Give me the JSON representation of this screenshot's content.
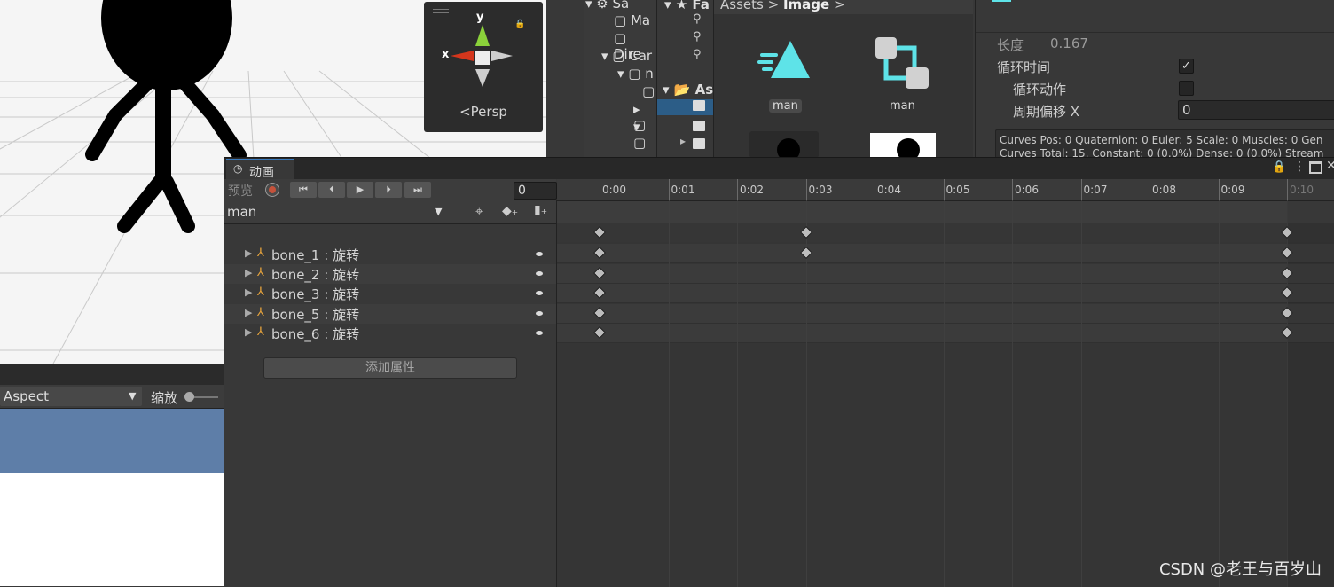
{
  "scene": {
    "gizmo": {
      "y_label": "y",
      "x_label": "x",
      "persp_label": "<Persp"
    }
  },
  "hierarchy": {
    "items": [
      "Sa",
      "Ma",
      "Dire",
      "Car",
      "n"
    ]
  },
  "favorites": {
    "label": "Fa"
  },
  "project": {
    "breadcrumb": [
      "Assets",
      "Image"
    ],
    "tree_label": "As",
    "assets": [
      {
        "name": "man",
        "selected": true
      },
      {
        "name": "man",
        "selected": false
      }
    ]
  },
  "inspector": {
    "length_label": "长度",
    "length_value": "0.167",
    "loop_time_label": "循环时间",
    "loop_time_checked": true,
    "loop_pose_label": "循环动作",
    "loop_pose_checked": false,
    "cycle_offset_label": "周期偏移 X",
    "cycle_offset_value": "0",
    "curves_line1": "Curves Pos: 0 Quaternion: 0 Euler: 5 Scale: 0 Muscles: 0 Gen",
    "curves_line2": "Curves Total: 15, Constant: 0 (0.0%) Dense: 0 (0.0%) Stream"
  },
  "game": {
    "aspect_label": "Aspect",
    "zoom_label": "缩放"
  },
  "animation": {
    "tab_label": "动画",
    "preview_label": "预览",
    "frame_value": "0",
    "clip_name": "man",
    "properties": [
      {
        "label": "bone_1 : 旋转"
      },
      {
        "label": "bone_2 : 旋转"
      },
      {
        "label": "bone_3 : 旋转"
      },
      {
        "label": "bone_5 : 旋转"
      },
      {
        "label": "bone_6 : 旋转"
      }
    ],
    "add_property_label": "添加属性",
    "ruler_ticks": [
      "0:00",
      "0:01",
      "0:02",
      "0:03",
      "0:04",
      "0:05",
      "0:06",
      "0:07",
      "0:08",
      "0:09",
      "0:10"
    ],
    "keyframes": {
      "summary": [
        0,
        3,
        10
      ],
      "bone_1": [
        0,
        3,
        10
      ],
      "bone_2": [
        0,
        10
      ],
      "bone_3": [
        0,
        10
      ],
      "bone_5": [
        0,
        10
      ],
      "bone_6": [
        0,
        10
      ]
    }
  },
  "watermark": "CSDN @老王与百岁山"
}
